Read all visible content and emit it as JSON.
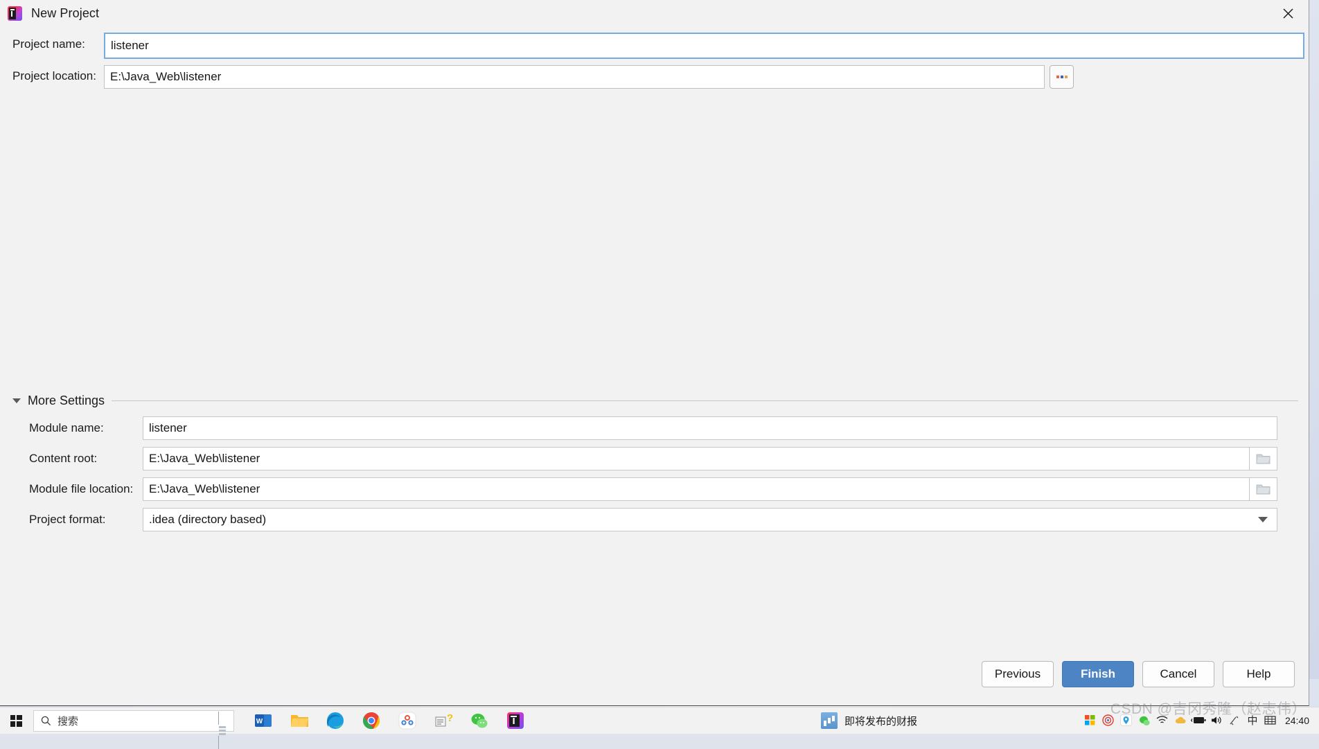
{
  "window": {
    "title": "New Project",
    "app_icon": "intellij-idea-icon",
    "close_icon": "close-icon"
  },
  "form": {
    "project_name": {
      "label": "Project name:",
      "value": "listener",
      "placeholder": ""
    },
    "project_location": {
      "label": "Project location:",
      "value": "E:\\Java_Web\\listener",
      "placeholder": "",
      "browse_label": "..."
    }
  },
  "more_settings": {
    "label": "More Settings",
    "expanded": true,
    "arrow_icon": "triangle-down-icon",
    "fields": [
      {
        "label": "Module name:",
        "value": "listener",
        "type": "text",
        "trailing_icon": ""
      },
      {
        "label": "Content root:",
        "value": "E:\\Java_Web\\listener",
        "type": "text",
        "trailing_icon": "folder-icon"
      },
      {
        "label": "Module file location:",
        "value": "E:\\Java_Web\\listener",
        "type": "text",
        "trailing_icon": "folder-icon"
      },
      {
        "label": "Project format:",
        "value": ".idea (directory based)",
        "type": "select",
        "trailing_icon": "chevron-down-icon"
      }
    ]
  },
  "buttons": {
    "previous": "Previous",
    "finish": "Finish",
    "cancel": "Cancel",
    "help": "Help",
    "primary_color": "#4c84c4"
  },
  "taskbar": {
    "start_icon": "windows-start-icon",
    "search": {
      "placeholder": "搜索",
      "icon": "search-icon",
      "widget_icon": "lighthouse-icon"
    },
    "apps": [
      {
        "name": "word-icon",
        "glyph": "W"
      },
      {
        "name": "file-explorer-icon",
        "glyph": ""
      },
      {
        "name": "edge-icon",
        "glyph": ""
      },
      {
        "name": "chrome-icon",
        "glyph": ""
      },
      {
        "name": "qq-meeting-icon",
        "glyph": ""
      },
      {
        "name": "help-icon",
        "glyph": "?"
      },
      {
        "name": "wechat-icon",
        "glyph": ""
      },
      {
        "name": "intellij-idea-icon",
        "glyph": "IJ"
      }
    ],
    "news": {
      "label": "即将发布的财报",
      "icon": "news-chart-icon"
    },
    "tray": [
      {
        "name": "microsoft-store-icon"
      },
      {
        "name": "recording-icon"
      },
      {
        "name": "location-icon"
      },
      {
        "name": "wechat-tray-icon"
      },
      {
        "name": "network-icon"
      },
      {
        "name": "cloud-icon"
      },
      {
        "name": "battery-icon"
      },
      {
        "name": "volume-icon"
      },
      {
        "name": "ime-tool-icon"
      },
      {
        "name": "ime-chinese-icon",
        "glyph": "中"
      },
      {
        "name": "keyboard-icon"
      }
    ],
    "clock": "24:40"
  },
  "watermark": "CSDN @吉冈秀隆（赵志伟）"
}
